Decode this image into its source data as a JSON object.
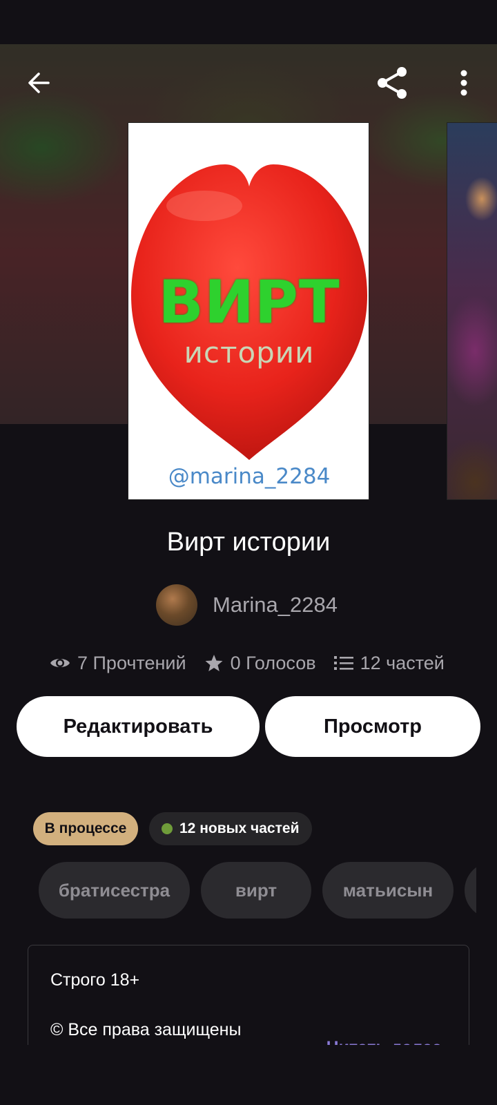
{
  "toolbar": {
    "back_icon": "arrow-left-icon",
    "share_icon": "share-icon",
    "more_icon": "more-vertical-icon"
  },
  "cover": {
    "title": "ВИРТ",
    "subtitle": "истории",
    "handle": "@marina_2284",
    "heart_color": "#e8231b",
    "title_color": "#2ed12e"
  },
  "story": {
    "title": "Вирт истории",
    "author": "Marina_2284"
  },
  "stats": {
    "reads": "7 Прочтений",
    "votes": "0 Голосов",
    "parts": "12 частей"
  },
  "actions": {
    "edit": "Редактировать",
    "preview": "Просмотр"
  },
  "badges": {
    "status": "В процессе",
    "new_parts": "12 новых частей",
    "status_color": "#d2b07e",
    "new_dot_color": "#6f9c3a"
  },
  "tags": [
    "братисестра",
    "вирт",
    "матьисын"
  ],
  "description": {
    "line1": "Строго 18+",
    "line2": "© Все права защищены",
    "read_more": "Читать далее"
  }
}
